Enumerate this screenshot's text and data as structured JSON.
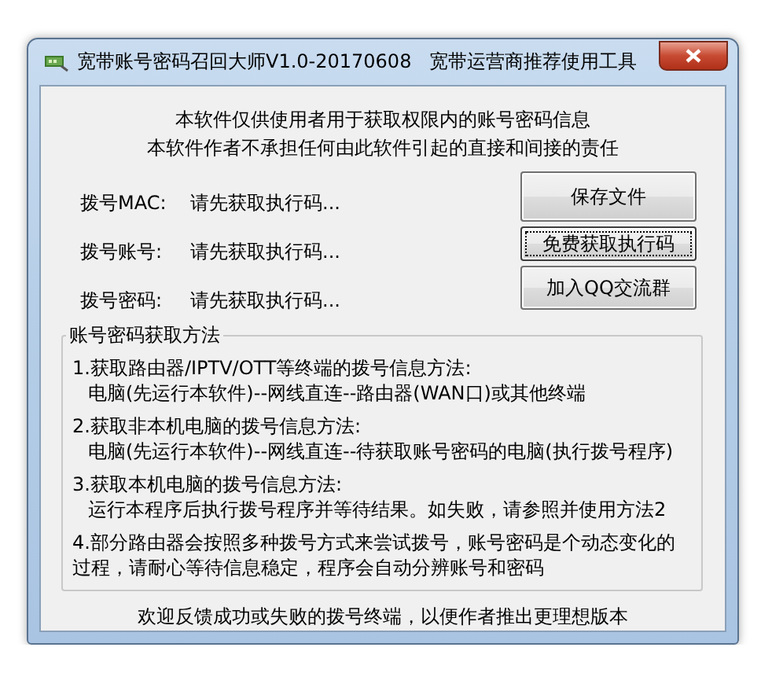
{
  "window": {
    "title": "宽带账号密码召回大师V1.0-20170608   宽带运营商推荐使用工具"
  },
  "notice": [
    "本软件仅供使用者用于获取权限内的账号密码信息",
    "本软件作者不承担任何由此软件引起的直接和间接的责任"
  ],
  "fields": [
    {
      "label": "拨号MAC:",
      "value": "请先获取执行码..."
    },
    {
      "label": "拨号账号:",
      "value": "请先获取执行码..."
    },
    {
      "label": "拨号密码:",
      "value": "请先获取执行码..."
    }
  ],
  "buttons": [
    {
      "label": "保存文件",
      "focused": false
    },
    {
      "label": "免费获取执行码",
      "focused": true
    },
    {
      "label": "加入QQ交流群",
      "focused": false
    }
  ],
  "methods": {
    "title": "账号密码获取方法",
    "items": [
      {
        "kind": "method",
        "heading": "1.获取路由器/IPTV/OTT等终端的拨号信息方法:",
        "detail": "电脑(先运行本软件)--网线直连--路由器(WAN口)或其他终端"
      },
      {
        "kind": "method",
        "heading": "2.获取非本机电脑的拨号信息方法:",
        "detail": "电脑(先运行本软件)--网线直连--待获取账号密码的电脑(执行拨号程序)"
      },
      {
        "kind": "method",
        "heading": "3.获取本机电脑的拨号信息方法:",
        "detail": "运行本程序后执行拨号程序并等待结果。如失败，请参照并使用方法2"
      },
      {
        "kind": "note",
        "lines": [
          "4.部分路由器会按照多种拨号方式来尝试拨号，账号密码是个动态变化的",
          "过程，请耐心等待信息稳定，程序会自动分辨账号和密码"
        ]
      }
    ]
  },
  "footer": "欢迎反馈成功或失败的拨号终端，以便作者推出更理想版本"
}
